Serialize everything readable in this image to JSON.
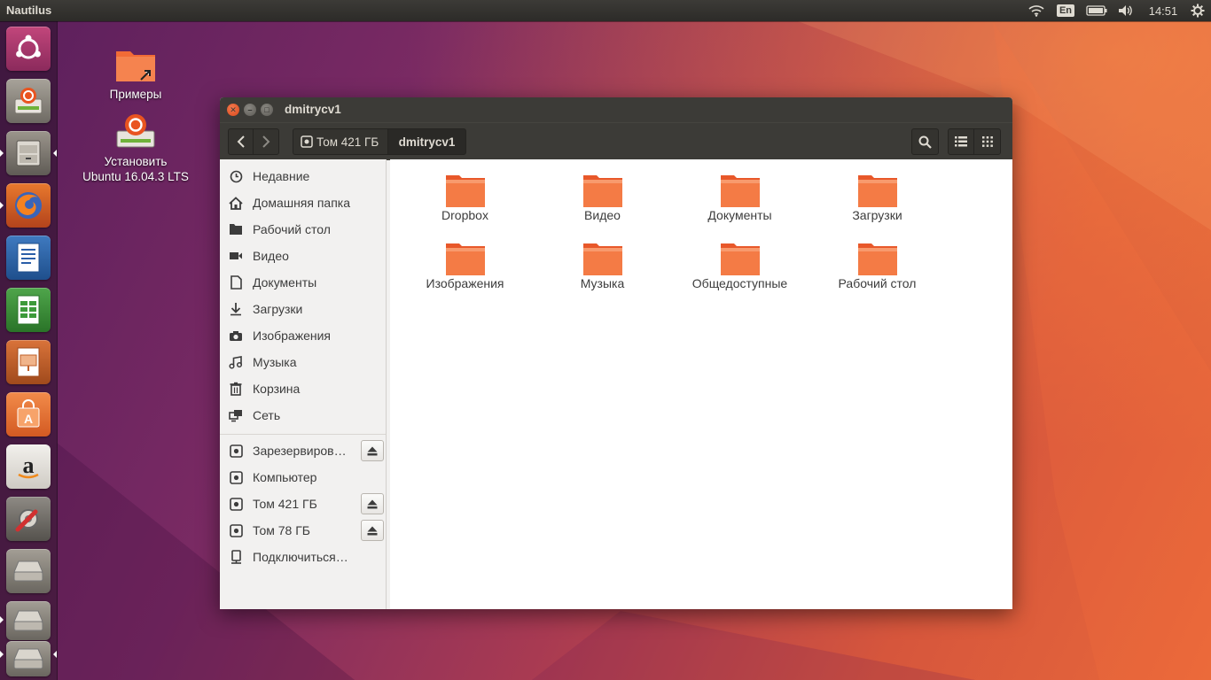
{
  "top_panel": {
    "app_title": "Nautilus",
    "keyboard_layout": "En",
    "clock": "14:51",
    "icons": [
      "wifi-icon",
      "battery-icon",
      "volume-icon",
      "session-gear-icon"
    ]
  },
  "launcher": {
    "items": [
      {
        "name": "ubuntu-dash"
      },
      {
        "name": "install-ubuntu"
      },
      {
        "name": "files"
      },
      {
        "name": "firefox"
      },
      {
        "name": "libreoffice-writer"
      },
      {
        "name": "libreoffice-calc"
      },
      {
        "name": "libreoffice-impress"
      },
      {
        "name": "ubuntu-software"
      },
      {
        "name": "amazon"
      },
      {
        "name": "system-settings"
      },
      {
        "name": "drive"
      },
      {
        "name": "drive"
      },
      {
        "name": "drive"
      }
    ]
  },
  "desktop": {
    "icons": [
      {
        "label": "Примеры"
      },
      {
        "label_line1": "Установить",
        "label_line2": "Ubuntu 16.04.3 LTS"
      }
    ]
  },
  "window": {
    "title": "dmitrycv1",
    "breadcrumb": [
      {
        "label": "Том 421 ГБ"
      },
      {
        "label": "dmitrycv1"
      }
    ],
    "sidebar": {
      "places": [
        {
          "label": "Недавние",
          "icon": "clock-icon"
        },
        {
          "label": "Домашняя папка",
          "icon": "home-icon"
        },
        {
          "label": "Рабочий стол",
          "icon": "desktop-folder-icon"
        },
        {
          "label": "Видео",
          "icon": "video-icon"
        },
        {
          "label": "Документы",
          "icon": "document-icon"
        },
        {
          "label": "Загрузки",
          "icon": "download-icon"
        },
        {
          "label": "Изображения",
          "icon": "camera-icon"
        },
        {
          "label": "Музыка",
          "icon": "music-icon"
        },
        {
          "label": "Корзина",
          "icon": "trash-icon"
        },
        {
          "label": "Сеть",
          "icon": "network-icon"
        }
      ],
      "devices": [
        {
          "label": "Зарезервиров…",
          "eject": true
        },
        {
          "label": "Компьютер",
          "eject": false
        },
        {
          "label": "Том 421 ГБ",
          "eject": true
        },
        {
          "label": "Том 78 ГБ",
          "eject": true
        },
        {
          "label": "Подключиться…",
          "eject": false
        }
      ]
    },
    "folders": [
      {
        "label": "Dropbox"
      },
      {
        "label": "Видео"
      },
      {
        "label": "Документы"
      },
      {
        "label": "Загрузки"
      },
      {
        "label": "Изображения"
      },
      {
        "label": "Музыка"
      },
      {
        "label": "Общедоступные"
      },
      {
        "label": "Рабочий стол"
      }
    ]
  },
  "colors": {
    "accent": "#f06a33",
    "panel": "#3c3b37",
    "folder": "#f26b36"
  }
}
